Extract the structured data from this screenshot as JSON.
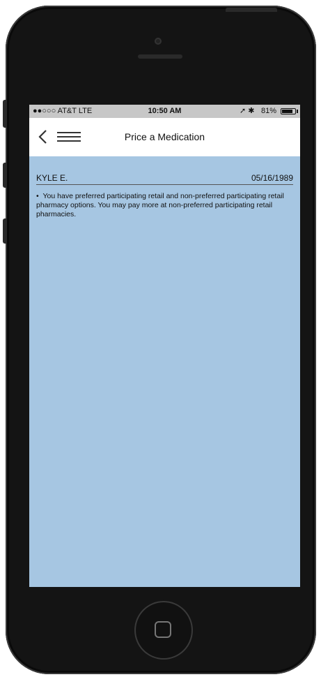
{
  "status_bar": {
    "carrier": "●●○○○ AT&T  LTE",
    "time": "10:50 AM",
    "battery": "81%",
    "battery_level": 0.81
  },
  "nav": {
    "title": "Price a Medication",
    "back_icon": "chevron-left-icon",
    "menu_icon": "hamburger-menu-icon"
  },
  "patient": {
    "name": "KYLE E.",
    "dob": "05/16/1989"
  },
  "notice": "You have preferred participating retail and non-preferred participating retail pharmacy options. You may pay more at non-preferred participating retail pharmacies.",
  "colors": {
    "screen_background": "#a6c6e2",
    "phone_body": "#141414",
    "navbar": "#ffffff"
  }
}
